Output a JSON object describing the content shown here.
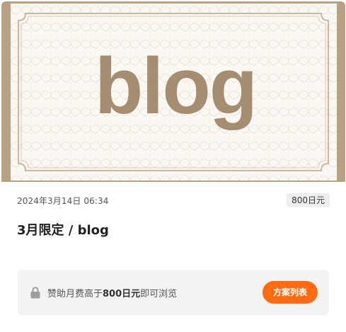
{
  "cover": {
    "logo_text": "blog"
  },
  "post": {
    "date": "2024年3月14日 06:34",
    "price": "800日元",
    "title": "3月限定 / blog"
  },
  "paywall": {
    "text_before": "赞助月费高于",
    "text_amount": "800日元",
    "text_after": "即可浏览",
    "button_label": "方案列表",
    "lock_icon": "lock-icon"
  },
  "colors": {
    "accent": "#ff6a13",
    "frame": "#b8a286",
    "logo": "#a58d72",
    "paper": "#fbf7f3"
  }
}
